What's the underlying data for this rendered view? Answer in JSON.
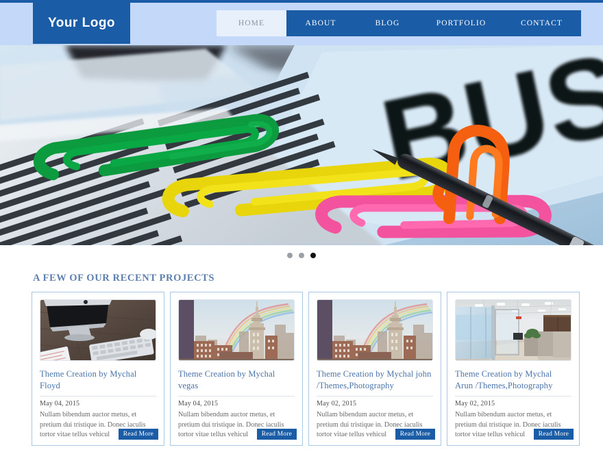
{
  "header": {
    "logo": "Your  Logo",
    "nav": [
      {
        "label": "HOME",
        "active": true
      },
      {
        "label": "ABOUT",
        "active": false
      },
      {
        "label": "BLOG",
        "active": false
      },
      {
        "label": "PORTFOLIO",
        "active": false
      },
      {
        "label": "CONTACT",
        "active": false
      }
    ],
    "colors": {
      "bar": "#1a5ca5",
      "background": "#c4d9fa",
      "active_tab_bg": "#e8f1fb"
    }
  },
  "hero": {
    "alt": "Close-up of colorful paperclips (green, yellow, orange, pink) lying on a newspaper next to a black pen and a light blue page with large BUS text",
    "overlay_word": "BUS",
    "carousel": {
      "dots": 3,
      "active_index": 2
    }
  },
  "projects": {
    "section_title": "A FEW OF OUR RECENT PROJECTS",
    "read_more_label": "Read More",
    "cards": [
      {
        "title": "Theme Creation by Mychal Floyd",
        "date": "May 04, 2015",
        "excerpt": "Nullam bibendum auctor metus, et pretium dui tristique in. Donec iaculis tortor vitae tellus vehicul",
        "thumb": "imac-desk"
      },
      {
        "title": "Theme Creation by Mychal vegas",
        "date": "May 04, 2015",
        "excerpt": "Nullam bibendum auctor metus, et pretium dui tristique in. Donec iaculis tortor vitae tellus vehicul",
        "thumb": "city-rainbow"
      },
      {
        "title": "Theme Creation by Mychal john /Themes,Photography",
        "date": "May 02, 2015",
        "excerpt": "Nullam bibendum auctor metus, et pretium dui tristique in. Donec iaculis tortor vitae tellus vehicul",
        "thumb": "city-rainbow"
      },
      {
        "title": "Theme Creation by Mychal Arun /Themes,Photography",
        "date": "May 02, 2015",
        "excerpt": "Nullam bibendum auctor metus, et pretium dui tristique in. Donec iaculis tortor vitae tellus vehicul",
        "thumb": "office-interior"
      }
    ]
  }
}
